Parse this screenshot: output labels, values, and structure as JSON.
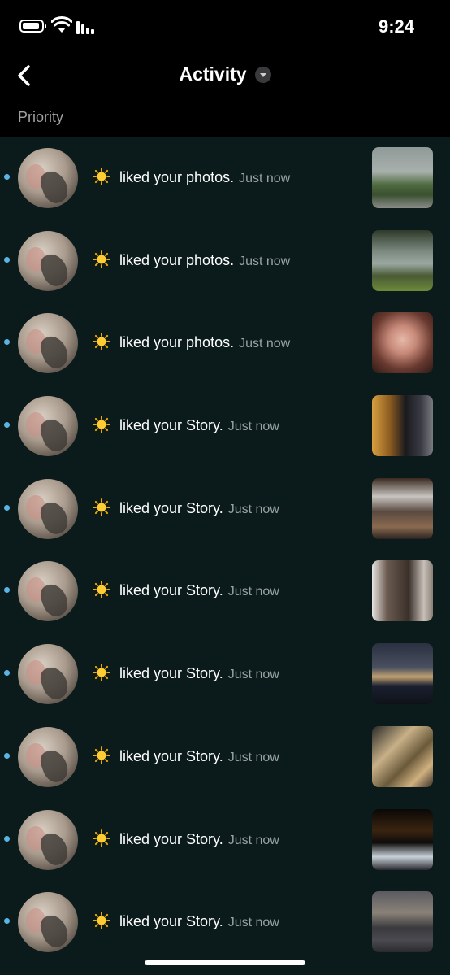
{
  "status_bar": {
    "time": "9:24"
  },
  "header": {
    "title": "Activity",
    "back_icon": "chevron-left-icon",
    "dropdown_icon": "caret-down-icon"
  },
  "section_label": "Priority",
  "colors": {
    "background": "#0b1b1b",
    "header_background": "#000000",
    "unread_dot": "#5ab4e6",
    "timestamp": "#9aa3a3"
  },
  "notifications": [
    {
      "emoji": "sun",
      "message": "liked your photos.",
      "time": "Just now",
      "thumb": "foggy-road"
    },
    {
      "emoji": "sun",
      "message": "liked your photos.",
      "time": "Just now",
      "thumb": "trees-lake"
    },
    {
      "emoji": "sun",
      "message": "liked your photos.",
      "time": "Just now",
      "thumb": "flower-bouquet"
    },
    {
      "emoji": "sun",
      "message": "liked your Story.",
      "time": "Just now",
      "thumb": "lit-hallway"
    },
    {
      "emoji": "sun",
      "message": "liked your Story.",
      "time": "Just now",
      "thumb": "cafe-counter"
    },
    {
      "emoji": "sun",
      "message": "liked your Story.",
      "time": "Just now",
      "thumb": "hotel-room"
    },
    {
      "emoji": "sun",
      "message": "liked your Story.",
      "time": "Just now",
      "thumb": "night-waterfront"
    },
    {
      "emoji": "sun",
      "message": "liked your Story.",
      "time": "Just now",
      "thumb": "desk-items"
    },
    {
      "emoji": "sun",
      "message": "liked your Story.",
      "time": "Just now",
      "thumb": "night-drinks"
    },
    {
      "emoji": "sun",
      "message": "liked your Story.",
      "time": "Just now",
      "thumb": "dusk-bay"
    }
  ]
}
